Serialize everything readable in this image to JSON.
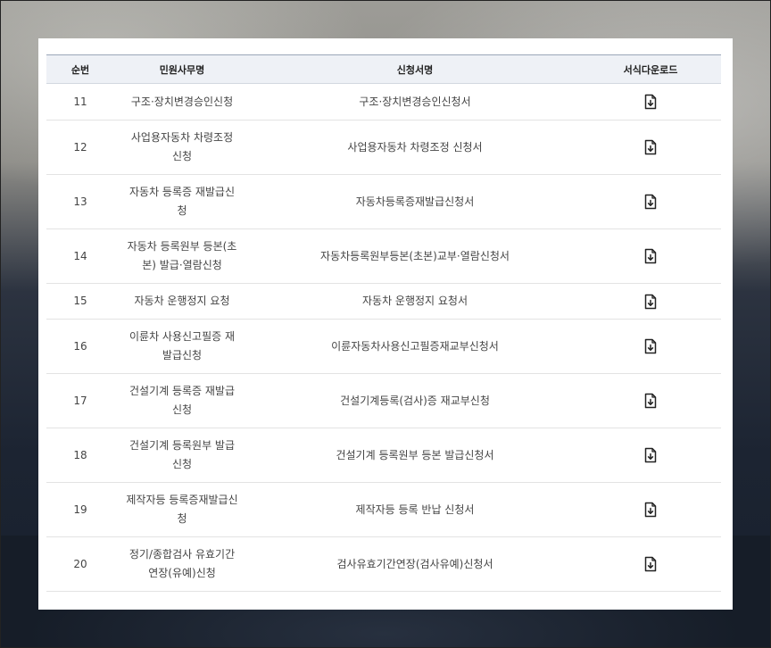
{
  "table": {
    "headers": {
      "no": "순번",
      "service": "민원사무명",
      "form": "신청서명",
      "download": "서식다운로드"
    },
    "rows": [
      {
        "no": "11",
        "service": "구조·장치변경승인신청",
        "form": "구조·장치변경승인신청서"
      },
      {
        "no": "12",
        "service": "사업용자동차 차령조정 신청",
        "form": "사업용자동차 차령조정 신청서"
      },
      {
        "no": "13",
        "service": "자동차 등록증 재발급신청",
        "form": "자동차등록증재발급신청서"
      },
      {
        "no": "14",
        "service": "자동차 등록원부 등본(초본) 발급·열람신청",
        "form": "자동차등록원부등본(초본)교부·열람신청서"
      },
      {
        "no": "15",
        "service": "자동차 운행정지 요청",
        "form": "자동차 운행정지 요청서"
      },
      {
        "no": "16",
        "service": "이륜차 사용신고필증 재발급신청",
        "form": "이륜자동차사용신고필증재교부신청서"
      },
      {
        "no": "17",
        "service": "건설기계 등록증 재발급신청",
        "form": "건설기계등록(검사)증 재교부신청"
      },
      {
        "no": "18",
        "service": "건설기계 등록원부 발급신청",
        "form": "건설기계 등록원부 등본 발급신청서"
      },
      {
        "no": "19",
        "service": "제작자등 등록증재발급신청",
        "form": "제작자등 등록 반납 신청서"
      },
      {
        "no": "20",
        "service": "정기/종합검사 유효기간 연장(유예)신청",
        "form": "검사유효기간연장(검사유예)신청서"
      }
    ]
  },
  "icons": {
    "download": "file-download-icon"
  },
  "colors": {
    "header_bg": "#eef1f6",
    "header_border": "#9aa6b8"
  }
}
